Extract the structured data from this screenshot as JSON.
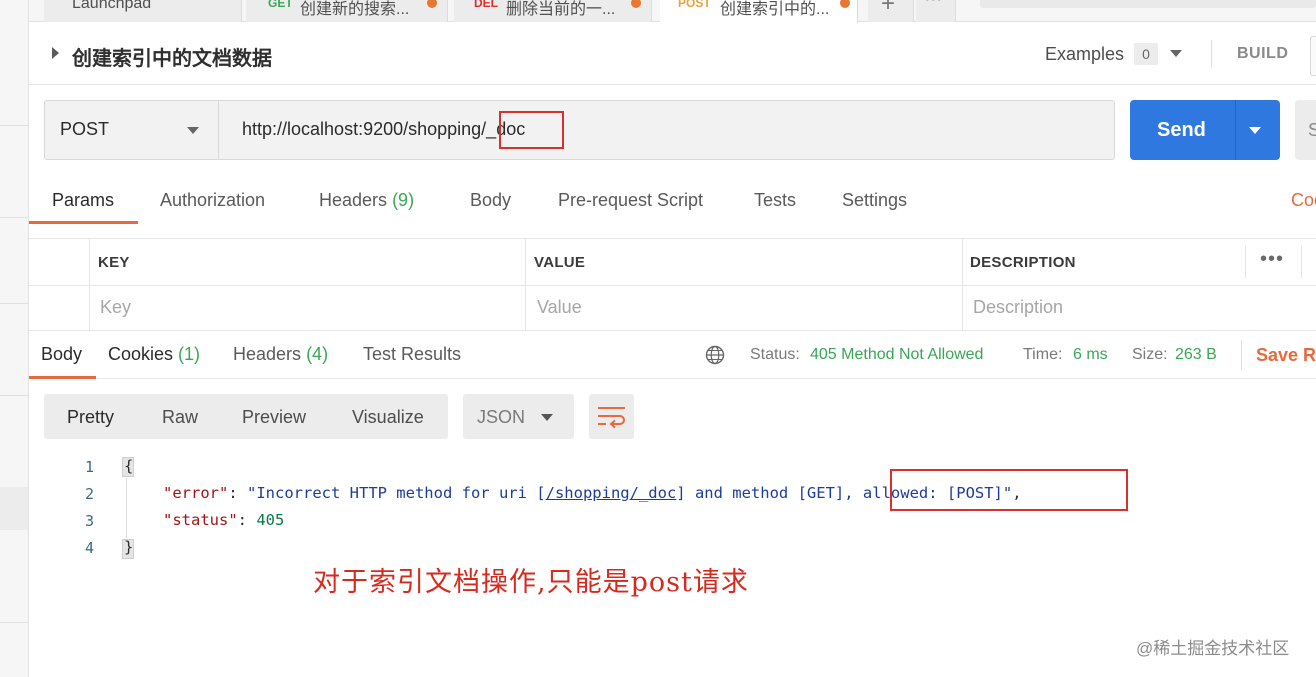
{
  "tabs": [
    {
      "method": "",
      "title": "Launchpad",
      "dot": false
    },
    {
      "method": "GET",
      "title": "创建新的搜索...",
      "dot": true,
      "color": "#3aa657"
    },
    {
      "method": "DEL",
      "title": "删除当前的一...",
      "dot": true,
      "color": "#d9302b"
    },
    {
      "method": "POST",
      "title": "创建索引中的...",
      "dot": true,
      "color": "#e8a33d"
    }
  ],
  "request": {
    "title": "创建索引中的文档数据",
    "examples_label": "Examples",
    "examples_count": "0",
    "build_label": "BUILD",
    "method": "POST",
    "url": "http://localhost:9200/shopping/_doc",
    "send_label": "Send",
    "save_partial": "S"
  },
  "request_tabs": [
    {
      "label": "Params",
      "count": ""
    },
    {
      "label": "Authorization",
      "count": ""
    },
    {
      "label": "Headers",
      "count": "(9)"
    },
    {
      "label": "Body",
      "count": ""
    },
    {
      "label": "Pre-request Script",
      "count": ""
    },
    {
      "label": "Tests",
      "count": ""
    },
    {
      "label": "Settings",
      "count": ""
    }
  ],
  "cookies_link": "Coo",
  "params_table": {
    "headers": [
      "KEY",
      "VALUE",
      "DESCRIPTION"
    ],
    "placeholders": [
      "Key",
      "Value",
      "Description"
    ],
    "more": "•••"
  },
  "response_tabs": [
    {
      "label": "Body",
      "count": ""
    },
    {
      "label": "Cookies",
      "count": "(1)"
    },
    {
      "label": "Headers",
      "count": "(4)"
    },
    {
      "label": "Test Results",
      "count": ""
    }
  ],
  "response_status": {
    "status_label": "Status:",
    "status_value": "405 Method Not Allowed",
    "time_label": "Time:",
    "time_value": "6 ms",
    "size_label": "Size:",
    "size_value": "263 B",
    "save_label": "Save Re"
  },
  "view_modes": [
    "Pretty",
    "Raw",
    "Preview",
    "Visualize"
  ],
  "format": "JSON",
  "code_lines": {
    "line_numbers": [
      "1",
      "2",
      "3",
      "4"
    ],
    "open_brace": "{",
    "close_brace": "}",
    "error_key": "\"error\"",
    "error_value_pre": "\"Incorrect HTTP method for uri [",
    "error_value_link": "/shopping/_doc",
    "error_value_post": "] and method [GET], allowed: [POST]\"",
    "status_key": "\"status\"",
    "status_value": "405"
  },
  "annotation": "对于索引文档操作,只能是post请求",
  "watermark": "@稀土掘金技术社区",
  "colors": {
    "accent": "#e8693d",
    "send": "#2f78e0",
    "success": "#3aa657",
    "highlight_box": "#d9302b"
  }
}
